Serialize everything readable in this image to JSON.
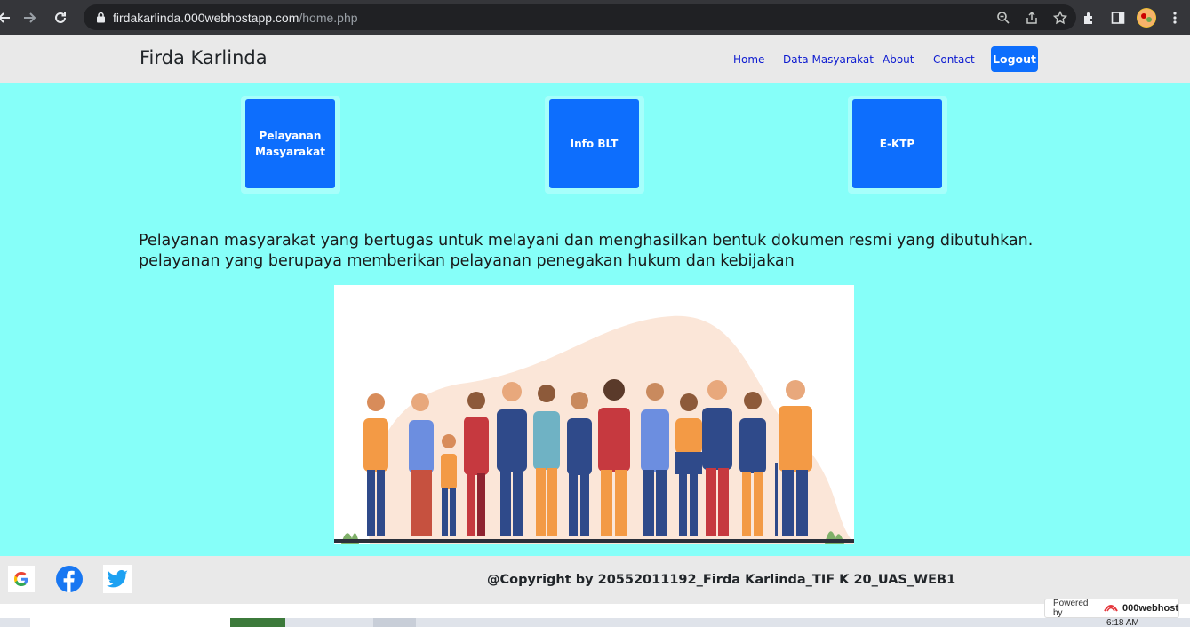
{
  "browser": {
    "url_host": "firdakarlinda.000webhostapp.com",
    "url_path": "/home.php"
  },
  "navbar": {
    "brand": "Firda Karlinda",
    "links": [
      {
        "label": "Home"
      },
      {
        "label": "Data Masyarakat"
      },
      {
        "label": "About"
      },
      {
        "label": "Contact"
      }
    ],
    "logout_label": "Logout"
  },
  "cards": [
    {
      "label": "Pelayanan Masyarakat"
    },
    {
      "label": "Info BLT"
    },
    {
      "label": "E-KTP"
    }
  ],
  "description": "Pelayanan masyarakat yang bertugas untuk melayani dan menghasilkan bentuk dokumen resmi yang dibutuhkan. pelayanan yang berupaya memberikan pelayanan penegakan hukum dan kebijakan",
  "footer": {
    "copyright": "@Copyright by 20552011192_Firda Karlinda_TIF K 20_UAS_WEB1",
    "social": [
      "google-icon",
      "facebook-icon",
      "twitter-icon"
    ]
  },
  "powered_by": {
    "prefix": "Powered by",
    "brand": "000webhost"
  },
  "taskbar": {
    "clock": "6:18 AM"
  },
  "colors": {
    "main_bg": "#86fff9",
    "primary": "#0d6efd",
    "navbar_bg": "#e9e9e9"
  }
}
